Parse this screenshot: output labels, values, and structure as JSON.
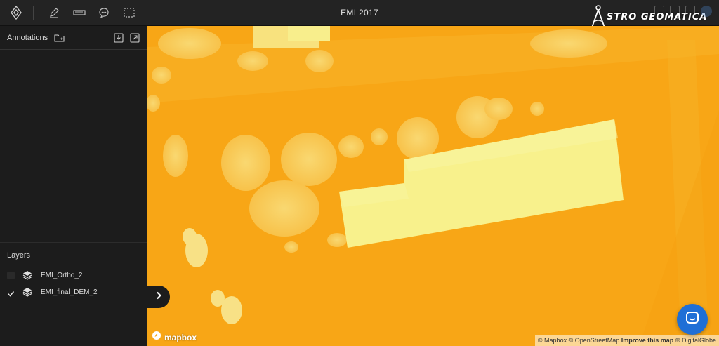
{
  "app": {
    "title": "EMI 2017",
    "logo_text": "STRO GEOMATICA"
  },
  "toolbar": {
    "tools": [
      {
        "name": "logo-diamond-icon"
      },
      {
        "name": "pencil-icon"
      },
      {
        "name": "ruler-icon"
      },
      {
        "name": "comment-icon"
      },
      {
        "name": "selection-icon"
      }
    ],
    "right_tools": [
      {
        "name": "share-icon"
      },
      {
        "name": "upload-icon"
      },
      {
        "name": "print-icon"
      },
      {
        "name": "profile-icon"
      }
    ]
  },
  "sidebar": {
    "annotations": {
      "label": "Annotations"
    },
    "layers": {
      "label": "Layers",
      "items": [
        {
          "label": "EMI_Ortho_2",
          "checked": false
        },
        {
          "label": "EMI_final_DEM_2",
          "checked": true
        }
      ]
    }
  },
  "map": {
    "logo": "mapbox",
    "attribution": {
      "mapbox": "© Mapbox",
      "osm": "© OpenStreetMap",
      "improve": "Improve this map",
      "digitalglobe": "© DigitalGlobe"
    },
    "colors": {
      "ground": "#f7a717",
      "high": "#f8f08a",
      "mid": "#f8d04a"
    }
  }
}
